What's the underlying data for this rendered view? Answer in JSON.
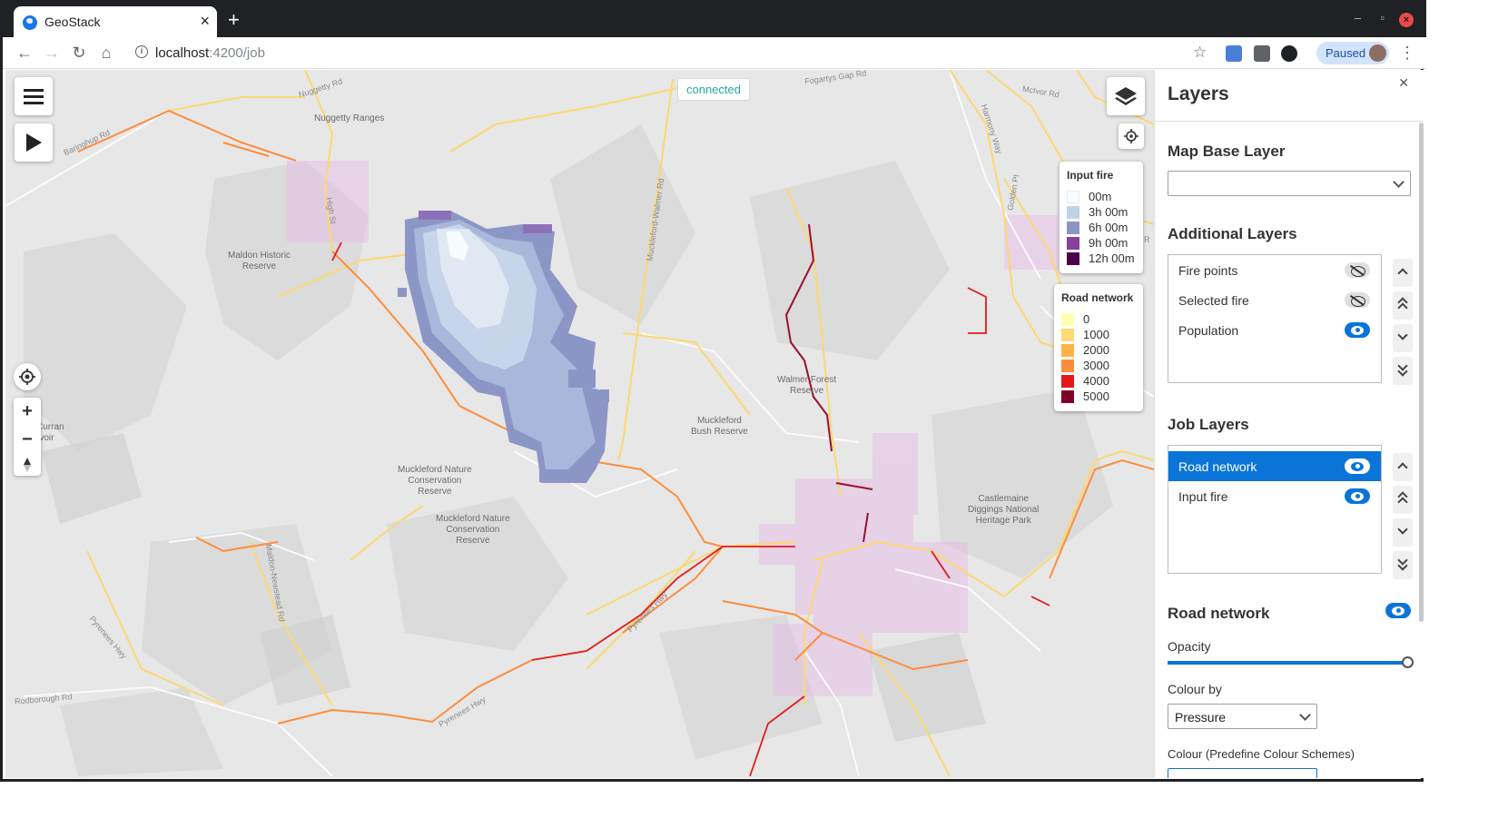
{
  "browser": {
    "tab_title": "GeoStack",
    "url_host": "localhost",
    "url_path": ":4200/job",
    "profile_status": "Paused"
  },
  "map": {
    "status": "connected",
    "place_labels": [
      "Nuggetty Ranges",
      "Maldon Historic\nReserve",
      "Walmer Forest\nReserve",
      "Muckleford\nBush Reserve",
      "Muckleford Nature\nConservation\nReserve",
      "Muckleford Nature\nConservation\nReserve",
      "Castlemaine\nDiggings National\nHeritage Park",
      "Curran\nrvoir"
    ],
    "road_labels": [
      "Nuggetty Rd",
      "Fogartys Gap Rd",
      "McIvor Rd",
      "Baringhup Rd",
      "High St",
      "Muckleford-Walmer Rd",
      "Harmony Way",
      "Golden Pt",
      "Maldon-Newstead Rd",
      "Pyrenees Hwy",
      "Pyrenees Hwy",
      "Pyrenees Hwy",
      "Rodborough Rd",
      "R"
    ],
    "legend_fire": {
      "title": "Input fire",
      "items": [
        {
          "label": "00m",
          "color": "#f7fcfd"
        },
        {
          "label": "3h 00m",
          "color": "#bfd3e6"
        },
        {
          "label": "6h 00m",
          "color": "#8c96c6"
        },
        {
          "label": "9h 00m",
          "color": "#88419d"
        },
        {
          "label": "12h 00m",
          "color": "#4d004b"
        }
      ]
    },
    "legend_road": {
      "title": "Road network",
      "items": [
        {
          "label": "0",
          "color": "#ffffb2"
        },
        {
          "label": "1000",
          "color": "#fed976"
        },
        {
          "label": "2000",
          "color": "#feb24c"
        },
        {
          "label": "3000",
          "color": "#fd8d3c"
        },
        {
          "label": "4000",
          "color": "#e31a1c"
        },
        {
          "label": "5000",
          "color": "#800026"
        }
      ]
    }
  },
  "panel": {
    "title": "Layers",
    "close_icon": "close-icon",
    "base_layer_heading": "Map Base Layer",
    "base_layer_value": "",
    "additional_heading": "Additional Layers",
    "additional_layers": [
      {
        "label": "Fire points",
        "visible": false
      },
      {
        "label": "Selected fire",
        "visible": false
      },
      {
        "label": "Population",
        "visible": true
      }
    ],
    "job_heading": "Job Layers",
    "job_layers": [
      {
        "label": "Road network",
        "visible": true,
        "selected": true
      },
      {
        "label": "Input fire",
        "visible": true,
        "selected": false
      }
    ],
    "detail_heading": "Road network",
    "opacity_label": "Opacity",
    "opacity_value": 1.0,
    "colour_by_label": "Colour by",
    "colour_by_value": "Pressure",
    "colour_scheme_label": "Colour (Predefine Colour Schemes)"
  }
}
